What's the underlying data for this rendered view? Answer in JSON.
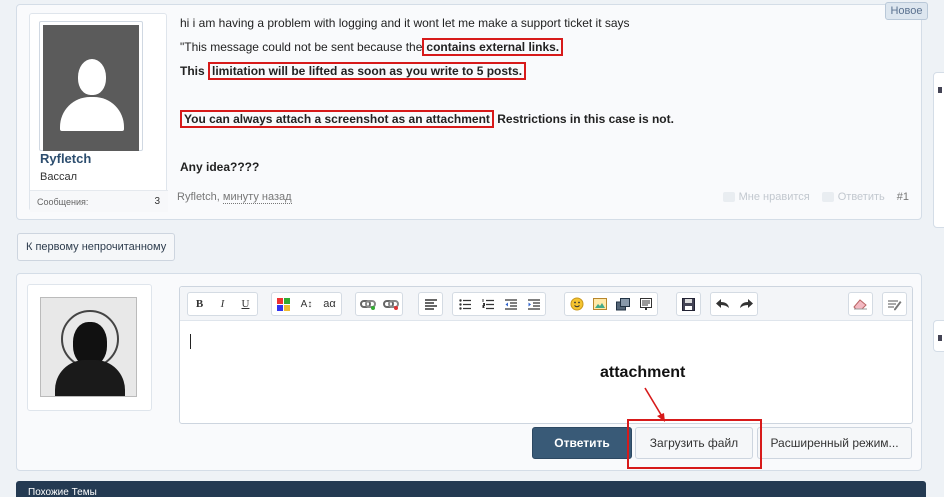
{
  "post": {
    "lines": [
      "hi i am having a problem with logging and it wont let me make a support ticket it says",
      "\"This message could not be sent because the",
      "contains external links.",
      "This",
      "limitation will be lifted as soon as you write to 5 posts.",
      "You can always attach a screenshot as an attachment",
      "Restrictions in this case is not.",
      "Any idea????"
    ],
    "author": "Ryfletch",
    "user_title": "Вассал",
    "stats_label": "Сообщения:",
    "stats_value": "3",
    "footer_author": "Ryfletch",
    "footer_time": "минуту назад",
    "like_label": "Мне нравится",
    "reply_label": "Ответить",
    "post_number": "#1",
    "new_badge": "Новое"
  },
  "nav": {
    "first_unread": "К первому непрочитанному"
  },
  "editor": {
    "toolbar_groups": [
      [
        "bold",
        "italic",
        "underline"
      ],
      [
        "text-color",
        "font-size",
        "font-family"
      ],
      [
        "link",
        "unlink"
      ],
      [
        "align"
      ],
      [
        "bullet-list",
        "numbered-list",
        "outdent",
        "indent"
      ],
      [
        "smilies",
        "image",
        "media",
        "code"
      ],
      [
        "save"
      ],
      [
        "undo",
        "redo"
      ],
      [
        "remove-format"
      ],
      [
        "toggle-bbcode"
      ]
    ],
    "toolbar_glyphs": {
      "bold": "B",
      "italic": "I",
      "underline": "U",
      "font-size": "A↕",
      "font-family": "aα"
    }
  },
  "annotation": {
    "label": "attachment"
  },
  "buttons": {
    "reply": "Ответить",
    "upload": "Загрузить файл",
    "advanced": "Расширенный режим..."
  },
  "similar": {
    "title": "Похожие Темы"
  },
  "colors": {
    "highlight": "#d71a1a",
    "primary_button": "#395a77",
    "header_bar": "#243a52"
  }
}
